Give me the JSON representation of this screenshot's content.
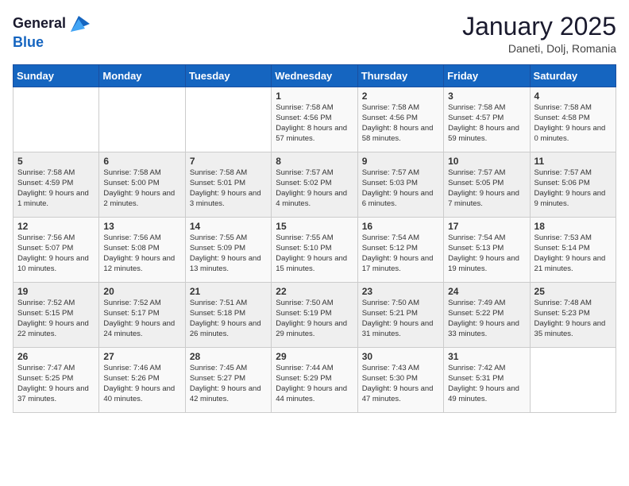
{
  "header": {
    "logo_general": "General",
    "logo_blue": "Blue",
    "month_title": "January 2025",
    "location": "Daneti, Dolj, Romania"
  },
  "weekdays": [
    "Sunday",
    "Monday",
    "Tuesday",
    "Wednesday",
    "Thursday",
    "Friday",
    "Saturday"
  ],
  "weeks": [
    [
      {
        "day": "",
        "text": ""
      },
      {
        "day": "",
        "text": ""
      },
      {
        "day": "",
        "text": ""
      },
      {
        "day": "1",
        "text": "Sunrise: 7:58 AM\nSunset: 4:56 PM\nDaylight: 8 hours and 57 minutes."
      },
      {
        "day": "2",
        "text": "Sunrise: 7:58 AM\nSunset: 4:56 PM\nDaylight: 8 hours and 58 minutes."
      },
      {
        "day": "3",
        "text": "Sunrise: 7:58 AM\nSunset: 4:57 PM\nDaylight: 8 hours and 59 minutes."
      },
      {
        "day": "4",
        "text": "Sunrise: 7:58 AM\nSunset: 4:58 PM\nDaylight: 9 hours and 0 minutes."
      }
    ],
    [
      {
        "day": "5",
        "text": "Sunrise: 7:58 AM\nSunset: 4:59 PM\nDaylight: 9 hours and 1 minute."
      },
      {
        "day": "6",
        "text": "Sunrise: 7:58 AM\nSunset: 5:00 PM\nDaylight: 9 hours and 2 minutes."
      },
      {
        "day": "7",
        "text": "Sunrise: 7:58 AM\nSunset: 5:01 PM\nDaylight: 9 hours and 3 minutes."
      },
      {
        "day": "8",
        "text": "Sunrise: 7:57 AM\nSunset: 5:02 PM\nDaylight: 9 hours and 4 minutes."
      },
      {
        "day": "9",
        "text": "Sunrise: 7:57 AM\nSunset: 5:03 PM\nDaylight: 9 hours and 6 minutes."
      },
      {
        "day": "10",
        "text": "Sunrise: 7:57 AM\nSunset: 5:05 PM\nDaylight: 9 hours and 7 minutes."
      },
      {
        "day": "11",
        "text": "Sunrise: 7:57 AM\nSunset: 5:06 PM\nDaylight: 9 hours and 9 minutes."
      }
    ],
    [
      {
        "day": "12",
        "text": "Sunrise: 7:56 AM\nSunset: 5:07 PM\nDaylight: 9 hours and 10 minutes."
      },
      {
        "day": "13",
        "text": "Sunrise: 7:56 AM\nSunset: 5:08 PM\nDaylight: 9 hours and 12 minutes."
      },
      {
        "day": "14",
        "text": "Sunrise: 7:55 AM\nSunset: 5:09 PM\nDaylight: 9 hours and 13 minutes."
      },
      {
        "day": "15",
        "text": "Sunrise: 7:55 AM\nSunset: 5:10 PM\nDaylight: 9 hours and 15 minutes."
      },
      {
        "day": "16",
        "text": "Sunrise: 7:54 AM\nSunset: 5:12 PM\nDaylight: 9 hours and 17 minutes."
      },
      {
        "day": "17",
        "text": "Sunrise: 7:54 AM\nSunset: 5:13 PM\nDaylight: 9 hours and 19 minutes."
      },
      {
        "day": "18",
        "text": "Sunrise: 7:53 AM\nSunset: 5:14 PM\nDaylight: 9 hours and 21 minutes."
      }
    ],
    [
      {
        "day": "19",
        "text": "Sunrise: 7:52 AM\nSunset: 5:15 PM\nDaylight: 9 hours and 22 minutes."
      },
      {
        "day": "20",
        "text": "Sunrise: 7:52 AM\nSunset: 5:17 PM\nDaylight: 9 hours and 24 minutes."
      },
      {
        "day": "21",
        "text": "Sunrise: 7:51 AM\nSunset: 5:18 PM\nDaylight: 9 hours and 26 minutes."
      },
      {
        "day": "22",
        "text": "Sunrise: 7:50 AM\nSunset: 5:19 PM\nDaylight: 9 hours and 29 minutes."
      },
      {
        "day": "23",
        "text": "Sunrise: 7:50 AM\nSunset: 5:21 PM\nDaylight: 9 hours and 31 minutes."
      },
      {
        "day": "24",
        "text": "Sunrise: 7:49 AM\nSunset: 5:22 PM\nDaylight: 9 hours and 33 minutes."
      },
      {
        "day": "25",
        "text": "Sunrise: 7:48 AM\nSunset: 5:23 PM\nDaylight: 9 hours and 35 minutes."
      }
    ],
    [
      {
        "day": "26",
        "text": "Sunrise: 7:47 AM\nSunset: 5:25 PM\nDaylight: 9 hours and 37 minutes."
      },
      {
        "day": "27",
        "text": "Sunrise: 7:46 AM\nSunset: 5:26 PM\nDaylight: 9 hours and 40 minutes."
      },
      {
        "day": "28",
        "text": "Sunrise: 7:45 AM\nSunset: 5:27 PM\nDaylight: 9 hours and 42 minutes."
      },
      {
        "day": "29",
        "text": "Sunrise: 7:44 AM\nSunset: 5:29 PM\nDaylight: 9 hours and 44 minutes."
      },
      {
        "day": "30",
        "text": "Sunrise: 7:43 AM\nSunset: 5:30 PM\nDaylight: 9 hours and 47 minutes."
      },
      {
        "day": "31",
        "text": "Sunrise: 7:42 AM\nSunset: 5:31 PM\nDaylight: 9 hours and 49 minutes."
      },
      {
        "day": "",
        "text": ""
      }
    ]
  ]
}
